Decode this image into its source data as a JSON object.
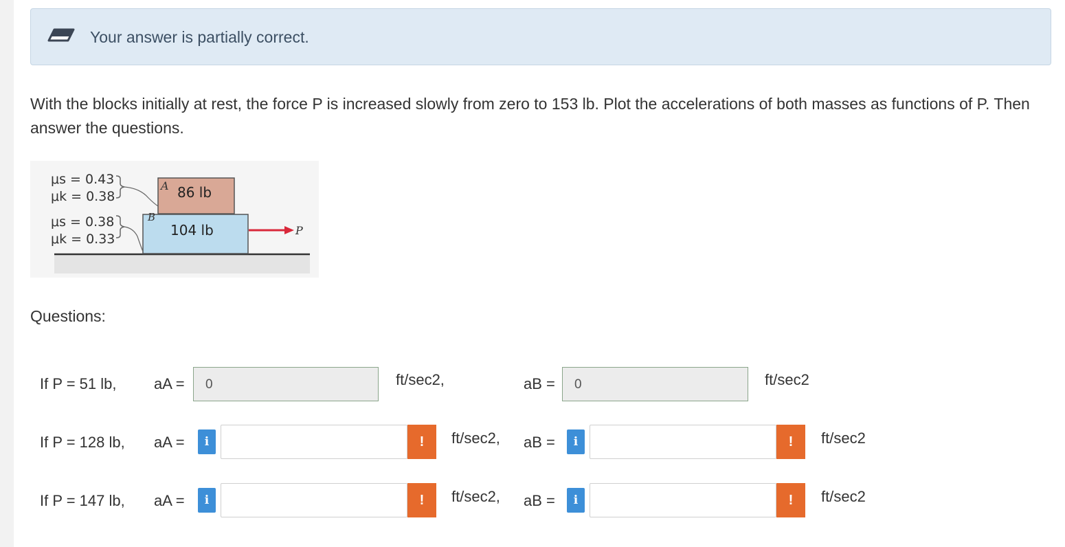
{
  "banner": {
    "message": "Your answer is partially correct.",
    "icon": "eraser-icon"
  },
  "question": {
    "text": "With the blocks initially at rest, the force P is increased slowly from zero to 153 lb. Plot the accelerations of both masses as functions of P. Then answer the questions.",
    "figure": {
      "upper_mu_s": "μs = 0.43",
      "upper_mu_k": "μk = 0.38",
      "lower_mu_s": "μs = 0.38",
      "lower_mu_k": "μk = 0.33",
      "block_a_letter": "A",
      "block_a_weight": "86 lb",
      "block_b_letter": "B",
      "block_b_weight": "104 lb",
      "force_label": "P"
    }
  },
  "questions_label": "Questions:",
  "rows": [
    {
      "prompt": "If P = 51 lb,",
      "aA_label": "aA =",
      "aA_value": "0",
      "aA_unit": "ft/sec2,",
      "aB_label": "aB =",
      "aB_value": "0",
      "aB_unit": "ft/sec2"
    },
    {
      "prompt": "If P = 128 lb,",
      "aA_label": "aA =",
      "aA_value": "",
      "aA_unit": "ft/sec2,",
      "aB_label": "aB =",
      "aB_value": "",
      "aB_unit": "ft/sec2"
    },
    {
      "prompt": "If P = 147 lb,",
      "aA_label": "aA =",
      "aA_value": "",
      "aA_unit": "ft/sec2,",
      "aB_label": "aB =",
      "aB_value": "",
      "aB_unit": "ft/sec2"
    }
  ],
  "controls": {
    "info_glyph": "i",
    "warning_glyph": "!"
  },
  "colors": {
    "banner_bg": "#dfeaf4",
    "info_blue": "#3d8fd8",
    "warning_orange": "#e66a2c",
    "block_a": "#d9a896",
    "block_b": "#bcdcee",
    "arrow_red": "#d9283a"
  }
}
